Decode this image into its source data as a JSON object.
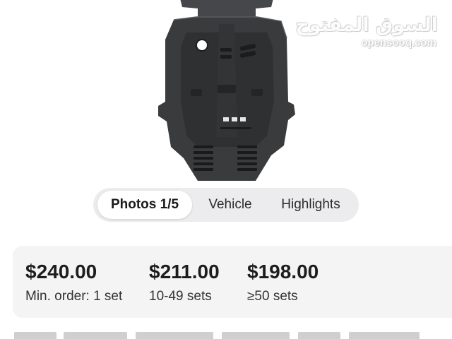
{
  "watermark": {
    "arabic": "السوق المفتوح",
    "latin": "opensooq.com"
  },
  "product_image": {
    "alt": "skid plate"
  },
  "tabs": [
    {
      "label": "Photos 1/5",
      "active": true
    },
    {
      "label": "Vehicle",
      "active": false
    },
    {
      "label": "Highlights",
      "active": false
    }
  ],
  "pricing": {
    "tiers": [
      {
        "price": "$240.00",
        "quantity": "Min. order: 1 set"
      },
      {
        "price": "$211.00",
        "quantity": "10-49 sets"
      },
      {
        "price": "$198.00",
        "quantity": "≥50 sets"
      }
    ]
  },
  "colors": {
    "tab_bar_bg": "#ececee",
    "active_tab_bg": "#ffffff",
    "price_card_bg": "#f4f4f5",
    "product_dark": "#3a3b3d"
  }
}
